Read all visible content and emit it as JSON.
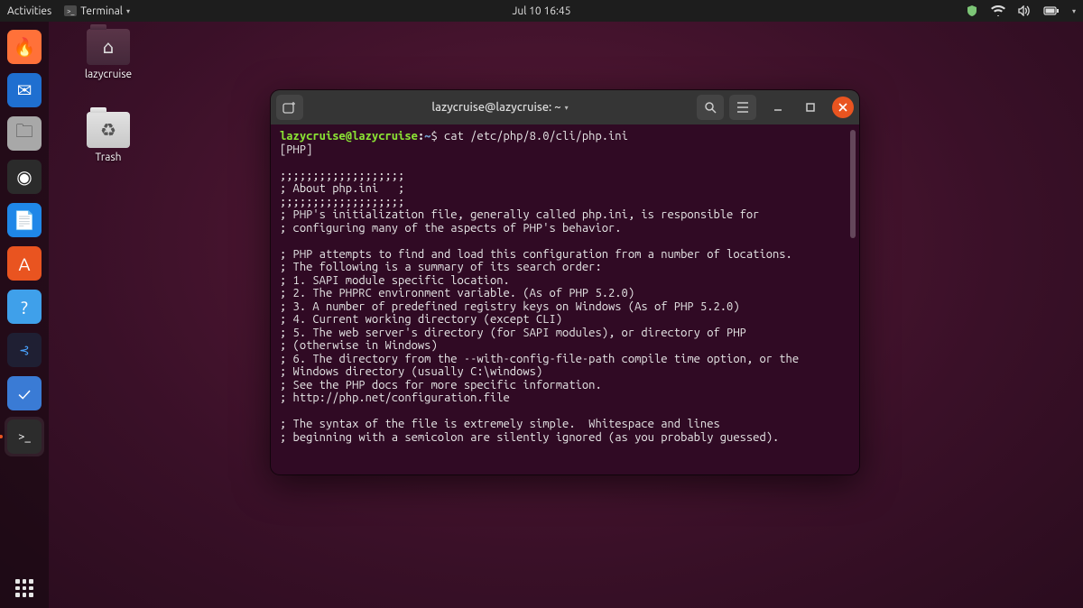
{
  "topbar": {
    "activities": "Activities",
    "app_indicator": "Terminal",
    "datetime": "Jul 10  16:45"
  },
  "desktop": {
    "home_label": "lazycruise",
    "trash_label": "Trash"
  },
  "dock": {
    "items": [
      {
        "name": "firefox",
        "color": "#ff7139",
        "glyph": "🦊"
      },
      {
        "name": "thunderbird",
        "color": "#1f6fd0",
        "glyph": "✉"
      },
      {
        "name": "files",
        "color": "#8e8e8e",
        "glyph": "📁"
      },
      {
        "name": "rhythmbox",
        "color": "#2b2b2b",
        "glyph": "◎"
      },
      {
        "name": "libreoffice-writer",
        "color": "#1f87e8",
        "glyph": "📄"
      },
      {
        "name": "ubuntu-software",
        "color": "#e95420",
        "glyph": "🛍"
      },
      {
        "name": "help",
        "color": "#3fa0ea",
        "glyph": "?"
      },
      {
        "name": "vscode",
        "color": "#1f1f33",
        "glyph": "❮❯"
      },
      {
        "name": "todo",
        "color": "#3a7bd5",
        "glyph": "✔"
      },
      {
        "name": "terminal",
        "color": "#2c2c2c",
        "glyph": ">_"
      }
    ]
  },
  "window": {
    "title": "lazycruise@lazycruise: ~"
  },
  "terminal": {
    "prompt_user": "lazycruise@lazycruise",
    "prompt_path": "~",
    "prompt_symbol": "$",
    "command": "cat /etc/php/8.0/cli/php.ini",
    "lines": [
      "[PHP]",
      "",
      ";;;;;;;;;;;;;;;;;;;",
      "; About php.ini   ;",
      ";;;;;;;;;;;;;;;;;;;",
      "; PHP's initialization file, generally called php.ini, is responsible for",
      "; configuring many of the aspects of PHP's behavior.",
      "",
      "; PHP attempts to find and load this configuration from a number of locations.",
      "; The following is a summary of its search order:",
      "; 1. SAPI module specific location.",
      "; 2. The PHPRC environment variable. (As of PHP 5.2.0)",
      "; 3. A number of predefined registry keys on Windows (As of PHP 5.2.0)",
      "; 4. Current working directory (except CLI)",
      "; 5. The web server's directory (for SAPI modules), or directory of PHP",
      "; (otherwise in Windows)",
      "; 6. The directory from the --with-config-file-path compile time option, or the",
      "; Windows directory (usually C:\\windows)",
      "; See the PHP docs for more specific information.",
      "; http://php.net/configuration.file",
      "",
      "; The syntax of the file is extremely simple.  Whitespace and lines",
      "; beginning with a semicolon are silently ignored (as you probably guessed)."
    ]
  }
}
